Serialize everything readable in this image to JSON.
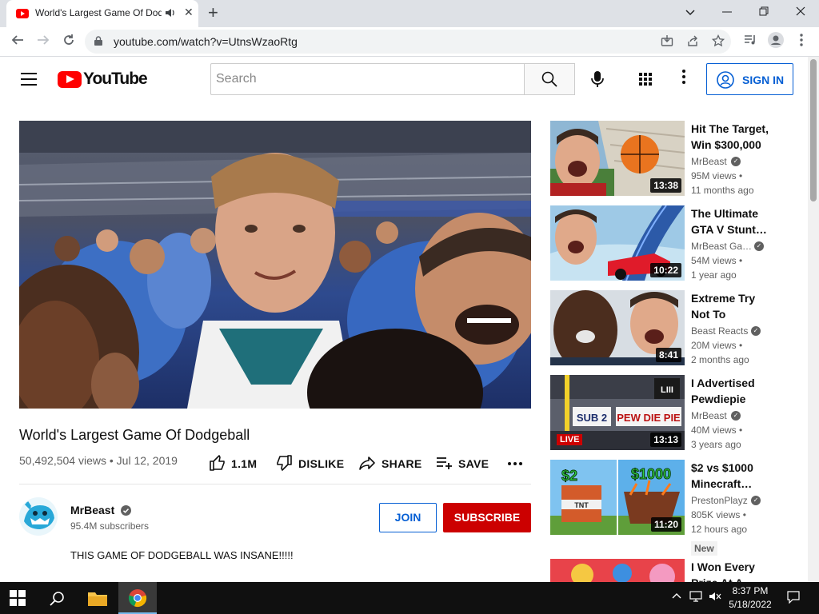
{
  "browser": {
    "tab_title": "World's Largest Game Of Dodgeball",
    "url": "youtube.com/watch?v=UtnsWzaoRtg",
    "new_tab_symbol": "+",
    "close_tab_symbol": "✕",
    "audio_icon": "speaker-icon"
  },
  "youtube": {
    "wordmark": "YouTube",
    "search_placeholder": "Search",
    "sign_in_label": "SIGN IN"
  },
  "video": {
    "title": "World's Largest Game Of Dodgeball",
    "views": "50,492,504 views",
    "separator": "•",
    "date": "Jul 12, 2019",
    "likes": "1.1M",
    "dislike_label": "DISLIKE",
    "share_label": "SHARE",
    "save_label": "SAVE",
    "more_symbol": "•••",
    "channel_name": "MrBeast",
    "subscribers": "95.4M subscribers",
    "join_label": "JOIN",
    "subscribe_label": "SUBSCRIBE",
    "description": "THIS GAME OF DODGEBALL WAS INSANE!!!!!"
  },
  "recommendations": [
    {
      "title": "Hit The Target, Win $300,000",
      "channel": "MrBeast",
      "views": "95M views",
      "age": "11 months ago",
      "duration": "13:38"
    },
    {
      "title": "The Ultimate GTA V Stunt…",
      "channel": "MrBeast Ga…",
      "views": "54M views",
      "age": "1 year ago",
      "duration": "10:22"
    },
    {
      "title": "Extreme Try Not To Laugh…",
      "channel": "Beast Reacts",
      "views": "20M views",
      "age": "2 months ago",
      "duration": "8:41"
    },
    {
      "title": "I Advertised Pewdiepie At…",
      "channel": "MrBeast",
      "views": "40M views",
      "age": "3 years ago",
      "duration": "13:13",
      "badge": "LIVE",
      "thumb_text_1": "SUB 2",
      "thumb_text_2": "PEW DIE PIE",
      "thumb_logo": "LIII"
    },
    {
      "title": "$2 vs $1000 Minecraft…",
      "channel": "PrestonPlayz",
      "views": "805K views",
      "age": "12 hours ago",
      "duration": "11:20",
      "new_badge": "New",
      "thumb_text_1": "$2",
      "thumb_text_2": "$1000",
      "thumb_text_3": "TNT"
    },
    {
      "title": "I Won Every Prize At A…"
    }
  ],
  "views_dot": "•",
  "taskbar": {
    "time": "8:37 PM",
    "date": "5/18/2022"
  },
  "colors": {
    "yt_red": "#ff0000",
    "subscribe_red": "#cc0000",
    "link_blue": "#065fd4",
    "taskbar": "#101010"
  }
}
